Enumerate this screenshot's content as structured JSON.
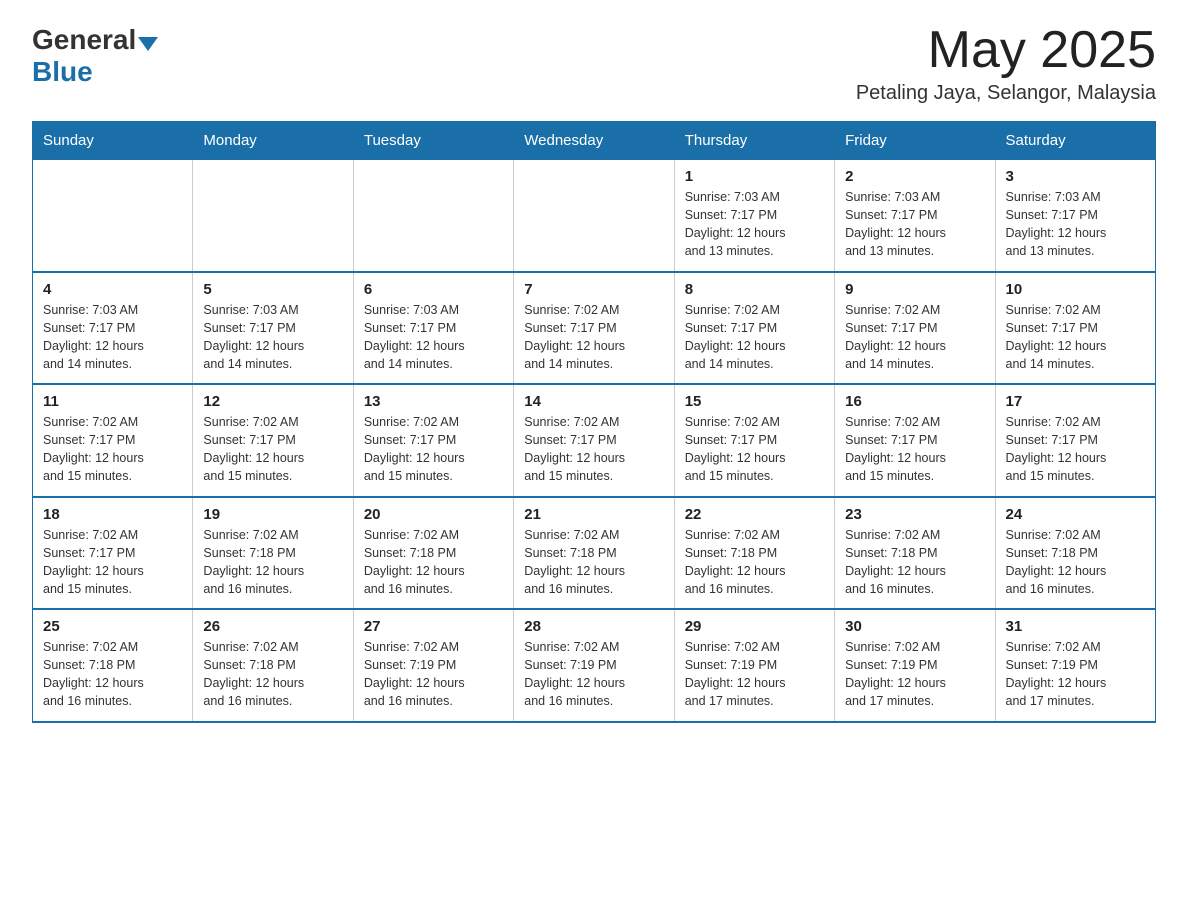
{
  "header": {
    "logo_general": "General",
    "logo_blue": "Blue",
    "month_title": "May 2025",
    "location": "Petaling Jaya, Selangor, Malaysia"
  },
  "days_of_week": [
    "Sunday",
    "Monday",
    "Tuesday",
    "Wednesday",
    "Thursday",
    "Friday",
    "Saturday"
  ],
  "weeks": [
    [
      {
        "day": "",
        "info": ""
      },
      {
        "day": "",
        "info": ""
      },
      {
        "day": "",
        "info": ""
      },
      {
        "day": "",
        "info": ""
      },
      {
        "day": "1",
        "info": "Sunrise: 7:03 AM\nSunset: 7:17 PM\nDaylight: 12 hours\nand 13 minutes."
      },
      {
        "day": "2",
        "info": "Sunrise: 7:03 AM\nSunset: 7:17 PM\nDaylight: 12 hours\nand 13 minutes."
      },
      {
        "day": "3",
        "info": "Sunrise: 7:03 AM\nSunset: 7:17 PM\nDaylight: 12 hours\nand 13 minutes."
      }
    ],
    [
      {
        "day": "4",
        "info": "Sunrise: 7:03 AM\nSunset: 7:17 PM\nDaylight: 12 hours\nand 14 minutes."
      },
      {
        "day": "5",
        "info": "Sunrise: 7:03 AM\nSunset: 7:17 PM\nDaylight: 12 hours\nand 14 minutes."
      },
      {
        "day": "6",
        "info": "Sunrise: 7:03 AM\nSunset: 7:17 PM\nDaylight: 12 hours\nand 14 minutes."
      },
      {
        "day": "7",
        "info": "Sunrise: 7:02 AM\nSunset: 7:17 PM\nDaylight: 12 hours\nand 14 minutes."
      },
      {
        "day": "8",
        "info": "Sunrise: 7:02 AM\nSunset: 7:17 PM\nDaylight: 12 hours\nand 14 minutes."
      },
      {
        "day": "9",
        "info": "Sunrise: 7:02 AM\nSunset: 7:17 PM\nDaylight: 12 hours\nand 14 minutes."
      },
      {
        "day": "10",
        "info": "Sunrise: 7:02 AM\nSunset: 7:17 PM\nDaylight: 12 hours\nand 14 minutes."
      }
    ],
    [
      {
        "day": "11",
        "info": "Sunrise: 7:02 AM\nSunset: 7:17 PM\nDaylight: 12 hours\nand 15 minutes."
      },
      {
        "day": "12",
        "info": "Sunrise: 7:02 AM\nSunset: 7:17 PM\nDaylight: 12 hours\nand 15 minutes."
      },
      {
        "day": "13",
        "info": "Sunrise: 7:02 AM\nSunset: 7:17 PM\nDaylight: 12 hours\nand 15 minutes."
      },
      {
        "day": "14",
        "info": "Sunrise: 7:02 AM\nSunset: 7:17 PM\nDaylight: 12 hours\nand 15 minutes."
      },
      {
        "day": "15",
        "info": "Sunrise: 7:02 AM\nSunset: 7:17 PM\nDaylight: 12 hours\nand 15 minutes."
      },
      {
        "day": "16",
        "info": "Sunrise: 7:02 AM\nSunset: 7:17 PM\nDaylight: 12 hours\nand 15 minutes."
      },
      {
        "day": "17",
        "info": "Sunrise: 7:02 AM\nSunset: 7:17 PM\nDaylight: 12 hours\nand 15 minutes."
      }
    ],
    [
      {
        "day": "18",
        "info": "Sunrise: 7:02 AM\nSunset: 7:17 PM\nDaylight: 12 hours\nand 15 minutes."
      },
      {
        "day": "19",
        "info": "Sunrise: 7:02 AM\nSunset: 7:18 PM\nDaylight: 12 hours\nand 16 minutes."
      },
      {
        "day": "20",
        "info": "Sunrise: 7:02 AM\nSunset: 7:18 PM\nDaylight: 12 hours\nand 16 minutes."
      },
      {
        "day": "21",
        "info": "Sunrise: 7:02 AM\nSunset: 7:18 PM\nDaylight: 12 hours\nand 16 minutes."
      },
      {
        "day": "22",
        "info": "Sunrise: 7:02 AM\nSunset: 7:18 PM\nDaylight: 12 hours\nand 16 minutes."
      },
      {
        "day": "23",
        "info": "Sunrise: 7:02 AM\nSunset: 7:18 PM\nDaylight: 12 hours\nand 16 minutes."
      },
      {
        "day": "24",
        "info": "Sunrise: 7:02 AM\nSunset: 7:18 PM\nDaylight: 12 hours\nand 16 minutes."
      }
    ],
    [
      {
        "day": "25",
        "info": "Sunrise: 7:02 AM\nSunset: 7:18 PM\nDaylight: 12 hours\nand 16 minutes."
      },
      {
        "day": "26",
        "info": "Sunrise: 7:02 AM\nSunset: 7:18 PM\nDaylight: 12 hours\nand 16 minutes."
      },
      {
        "day": "27",
        "info": "Sunrise: 7:02 AM\nSunset: 7:19 PM\nDaylight: 12 hours\nand 16 minutes."
      },
      {
        "day": "28",
        "info": "Sunrise: 7:02 AM\nSunset: 7:19 PM\nDaylight: 12 hours\nand 16 minutes."
      },
      {
        "day": "29",
        "info": "Sunrise: 7:02 AM\nSunset: 7:19 PM\nDaylight: 12 hours\nand 17 minutes."
      },
      {
        "day": "30",
        "info": "Sunrise: 7:02 AM\nSunset: 7:19 PM\nDaylight: 12 hours\nand 17 minutes."
      },
      {
        "day": "31",
        "info": "Sunrise: 7:02 AM\nSunset: 7:19 PM\nDaylight: 12 hours\nand 17 minutes."
      }
    ]
  ]
}
